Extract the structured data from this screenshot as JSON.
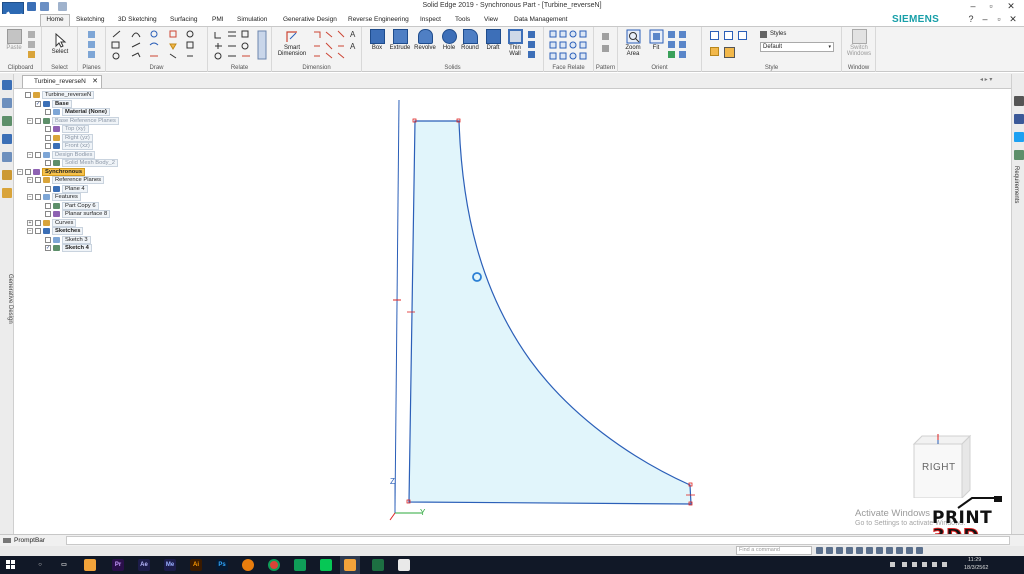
{
  "window": {
    "title": "Solid Edge 2019 - Synchronous Part - [Turbine_reverseN]",
    "brand": "SIEMENS",
    "controls": [
      "–",
      "▫",
      "✕"
    ],
    "doc_controls": [
      "?",
      "–",
      "▫",
      "✕"
    ]
  },
  "ribbon": {
    "tabs": [
      "Home",
      "Sketching",
      "3D Sketching",
      "Surfacing",
      "PMI",
      "Simulation",
      "Generative Design",
      "Reverse Engineering",
      "Inspect",
      "Tools",
      "View",
      "Data Management"
    ],
    "active_tab": "Home",
    "groups": {
      "clipboard": {
        "label": "Clipboard",
        "paste": "Paste"
      },
      "select": {
        "label": "Select",
        "select": "Select"
      },
      "planes": {
        "label": "Planes"
      },
      "draw": {
        "label": "Draw"
      },
      "relate": {
        "label": "Relate"
      },
      "dimension": {
        "label": "Dimension",
        "smart_dimension": "Smart Dimension"
      },
      "solids": {
        "label": "Solids",
        "box": "Box",
        "extrude": "Extrude",
        "revolve": "Revolve",
        "hole": "Hole",
        "round": "Round",
        "draft": "Draft",
        "thin_wall": "Thin Wall"
      },
      "face_relate": {
        "label": "Face Relate"
      },
      "pattern": {
        "label": "Pattern"
      },
      "orient": {
        "label": "Orient",
        "zoom_area": "Zoom Area",
        "fit": "Fit"
      },
      "style": {
        "label": "Style",
        "styles": "Styles",
        "default": "Default"
      },
      "window": {
        "label": "Window",
        "switch_windows": "Switch Windows"
      }
    }
  },
  "document_tab": {
    "name": "Turbine_reverseN"
  },
  "left_bar": {
    "generative_design": "Generative Design"
  },
  "right_bar": {
    "requirements": "Requirements"
  },
  "tree": [
    {
      "label": "Turbine_reverseN",
      "level": 0,
      "style": "normal",
      "expander": "",
      "checked": false
    },
    {
      "label": "Base",
      "level": 1,
      "style": "bold",
      "expander": "",
      "checked": true
    },
    {
      "label": "Material (None)",
      "level": 2,
      "style": "bold",
      "expander": "",
      "checked": false
    },
    {
      "label": "Base Reference Planes",
      "level": 1,
      "style": "dim",
      "expander": "−",
      "checked": false
    },
    {
      "label": "Top (xy)",
      "level": 2,
      "style": "dim",
      "expander": "",
      "checked": false
    },
    {
      "label": "Right (yz)",
      "level": 2,
      "style": "dim",
      "expander": "",
      "checked": false
    },
    {
      "label": "Front (xz)",
      "level": 2,
      "style": "dim",
      "expander": "",
      "checked": false
    },
    {
      "label": "Design Bodies",
      "level": 1,
      "style": "dim",
      "expander": "−",
      "checked": false
    },
    {
      "label": "Solid Mesh Body_2",
      "level": 2,
      "style": "dim",
      "expander": "",
      "checked": false
    },
    {
      "label": "Synchronous",
      "level": 0,
      "style": "highlight",
      "expander": "−",
      "checked": false
    },
    {
      "label": "Reference Planes",
      "level": 1,
      "style": "normal",
      "expander": "−",
      "checked": false
    },
    {
      "label": "Plane 4",
      "level": 2,
      "style": "normal",
      "expander": "",
      "checked": false
    },
    {
      "label": "Features",
      "level": 1,
      "style": "normal",
      "expander": "−",
      "checked": false
    },
    {
      "label": "Part Copy 6",
      "level": 2,
      "style": "normal",
      "expander": "",
      "checked": false
    },
    {
      "label": "Planar surface 8",
      "level": 2,
      "style": "normal",
      "expander": "",
      "checked": false
    },
    {
      "label": "Curves",
      "level": 1,
      "style": "normal",
      "expander": "+",
      "checked": false
    },
    {
      "label": "Sketches",
      "level": 1,
      "style": "bold",
      "expander": "−",
      "checked": false
    },
    {
      "label": "Sketch 3",
      "level": 2,
      "style": "normal",
      "expander": "",
      "checked": false
    },
    {
      "label": "Sketch 4",
      "level": 2,
      "style": "bold",
      "expander": "",
      "checked": true
    }
  ],
  "viewport": {
    "view_cube_label": "RIGHT",
    "axis_z": "Z",
    "axis_y": "Y",
    "sketch_fill": "#e1f5fb",
    "sketch_stroke": "#2b5fb8"
  },
  "watermark": {
    "title": "Activate Windows",
    "subtitle": "Go to Settings to activate Windows.",
    "logo_word": "PRINT",
    "logo_num": "3DD"
  },
  "prompt_bar": {
    "label": "PromptBar",
    "value": ""
  },
  "status_bar": {
    "find_placeholder": "Find a command"
  },
  "taskbar": {
    "apps": [
      "Search",
      "Task View",
      "File Manager",
      "Premiere",
      "After Effects",
      "Media Encoder",
      "Illustrator",
      "Photoshop",
      "Blender",
      "Chrome",
      "Sheets",
      "LINE",
      "Solid Edge",
      "Excel",
      "Note"
    ],
    "time": "11:29",
    "date": "18/3/2562"
  }
}
